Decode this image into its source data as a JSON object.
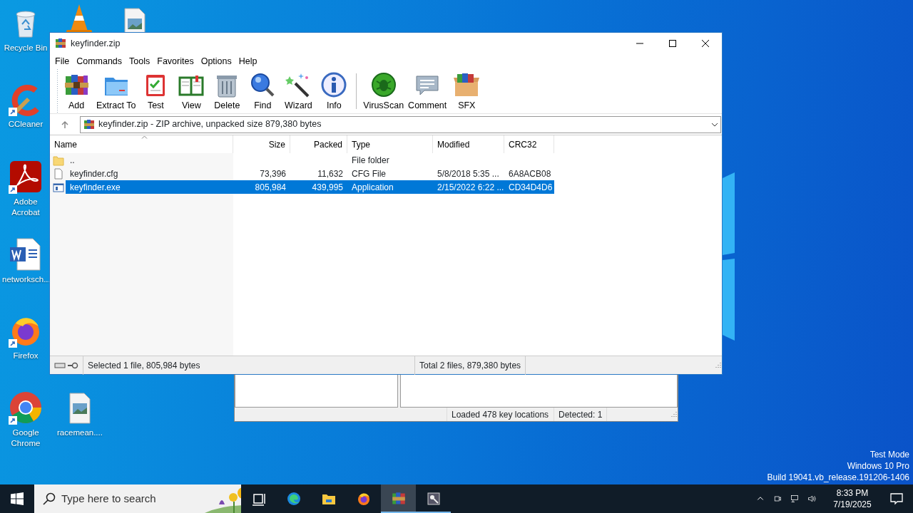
{
  "desktop_icons": [
    {
      "kind": "recycle-bin",
      "label": "Recycle Bin",
      "shortcut": false
    },
    {
      "kind": "traffic-cone"
    },
    {
      "kind": "image-file"
    },
    {
      "kind": "ccleaner",
      "label": "CCleaner",
      "shortcut": true
    },
    {
      "kind": "acrobat",
      "label": "Adobe Acrobat",
      "shortcut": true
    },
    {
      "kind": "word-doc",
      "label": "networksch...",
      "shortcut": false
    },
    {
      "kind": "firefox",
      "label": "Firefox",
      "shortcut": true
    },
    {
      "kind": "chrome",
      "label": "Google Chrome",
      "shortcut": true
    },
    {
      "kind": "image-file",
      "label": "racemean....",
      "shortcut": false
    }
  ],
  "scanner_window": {
    "status": [
      "Loaded 478 key locations",
      "Detected: 1"
    ]
  },
  "archive_window": {
    "title": "keyfinder.zip",
    "menu": [
      "File",
      "Commands",
      "Tools",
      "Favorites",
      "Options",
      "Help"
    ],
    "toolbar_groups": [
      {
        "buttons": [
          {
            "kind": "add",
            "label": "Add"
          },
          {
            "kind": "extract",
            "label": "Extract To"
          },
          {
            "kind": "test",
            "label": "Test"
          },
          {
            "kind": "view",
            "label": "View"
          },
          {
            "kind": "delete",
            "label": "Delete"
          },
          {
            "kind": "find",
            "label": "Find"
          },
          {
            "kind": "wizard",
            "label": "Wizard"
          },
          {
            "kind": "info",
            "label": "Info"
          }
        ]
      },
      {
        "buttons": [
          {
            "kind": "virusscan",
            "label": "VirusScan"
          },
          {
            "kind": "comment",
            "label": "Comment"
          },
          {
            "kind": "sfx",
            "label": "SFX"
          }
        ]
      }
    ],
    "path": "keyfinder.zip - ZIP archive, unpacked size 879,380 bytes",
    "columns": [
      {
        "label": "Name",
        "sorted": true
      },
      {
        "label": "Size",
        "sorted": false
      },
      {
        "label": "Packed",
        "sorted": false
      },
      {
        "label": "Type",
        "sorted": false
      },
      {
        "label": "Modified",
        "sorted": false
      },
      {
        "label": "CRC32",
        "sorted": false
      }
    ],
    "rows": [
      {
        "kind": "folder",
        "name": "..",
        "type": "File folder",
        "selected": false
      },
      {
        "kind": "file",
        "name": "keyfinder.cfg",
        "size": "73,396",
        "packed": "11,632",
        "type": "CFG File",
        "modified": "5/8/2018 5:35 ...",
        "crc32": "6A8ACB08",
        "selected": false
      },
      {
        "kind": "program",
        "name": "keyfinder.exe",
        "size": "805,984",
        "packed": "439,995",
        "type": "Application",
        "modified": "2/15/2022 6:22 ...",
        "crc32": "CD34D4D6",
        "selected": true
      }
    ],
    "status": [
      "Selected 1 file, 805,984 bytes",
      "Total 2 files, 879,380 bytes"
    ]
  },
  "os_watermark": [
    "Test Mode",
    "Windows 10 Pro",
    "Build 19041.vb_release.191206-1406"
  ],
  "taskbar": {
    "search_placeholder": "Type here to search",
    "apps": [
      {
        "kind": "task-view",
        "selected": false,
        "running": false
      },
      {
        "kind": "edge",
        "selected": false,
        "running": false
      },
      {
        "kind": "explorer",
        "selected": false,
        "running": false
      },
      {
        "kind": "firefox",
        "selected": false,
        "running": false
      },
      {
        "kind": "winrar",
        "selected": true,
        "running": true
      },
      {
        "kind": "keyfinder",
        "selected": false,
        "running": true
      }
    ],
    "time": "8:33 PM",
    "date": "7/19/2025"
  }
}
